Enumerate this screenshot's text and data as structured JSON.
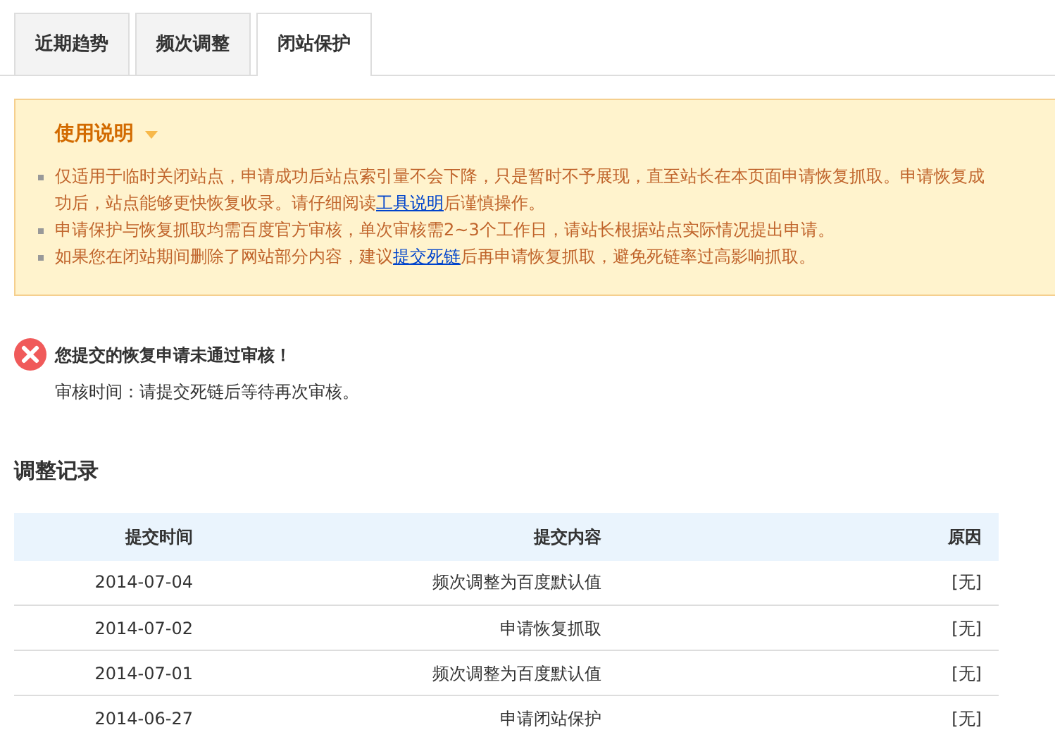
{
  "tabs": [
    {
      "label": "近期趋势",
      "selected": false
    },
    {
      "label": "频次调整",
      "selected": false
    },
    {
      "label": "闭站保护",
      "selected": true
    }
  ],
  "notice": {
    "title": "使用说明",
    "expanded": true,
    "items": [
      [
        {
          "text": "仅适用于临时关闭站点，申请成功后站点索引量不会下降，只是暂时不予展现，直至站长在本页面申请恢复抓取。申请恢复成功后，站点能够更快恢复收录。请仔细阅读"
        },
        {
          "text": "工具说明",
          "link": true
        },
        {
          "text": "后谨慎操作。"
        }
      ],
      [
        {
          "text": "申请保护与恢复抓取均需百度官方审核，单次审核需2~3个工作日，请站长根据站点实际情况提出申请。"
        }
      ],
      [
        {
          "text": "如果您在闭站期间删除了网站部分内容，建议"
        },
        {
          "text": "提交死链",
          "link": true
        },
        {
          "text": "后再申请恢复抓取，避免死链率过高影响抓取。"
        }
      ]
    ]
  },
  "status": {
    "kind": "error",
    "message": "您提交的恢复申请未通过审核！",
    "detail": "审核时间：请提交死链后等待再次审核。"
  },
  "records": {
    "title": "调整记录",
    "columns": [
      "提交时间",
      "提交内容",
      "原因"
    ],
    "rows": [
      [
        "2014-07-04",
        "频次调整为百度默认值",
        "[无]"
      ],
      [
        "2014-07-02",
        "申请恢复抓取",
        "[无]"
      ],
      [
        "2014-07-01",
        "频次调整为百度默认值",
        "[无]"
      ],
      [
        "2014-06-27",
        "申请闭站保护",
        "[无]"
      ]
    ]
  }
}
